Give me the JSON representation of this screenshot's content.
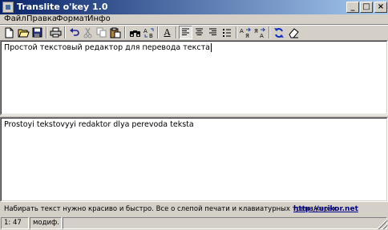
{
  "window": {
    "title": "Translite o'key 1.0",
    "minimize": "_",
    "maximize": "□",
    "close": "×"
  },
  "menu": [
    "Файл",
    "Правка",
    "Формат",
    "Инфо"
  ],
  "toolbar": {
    "buttons": [
      "new-file",
      "open-folder",
      "save",
      "print",
      "undo",
      "cut",
      "copy",
      "paste",
      "find",
      "replace",
      "font",
      "align-left",
      "align-center",
      "align-right",
      "bullet-list",
      "transliterate-forward",
      "transliterate-backward",
      "convert",
      "clear"
    ],
    "font_glyph": "A",
    "accent": "#0a246a"
  },
  "editor": {
    "source_text": "Простой текстовый редактор для перевода текста",
    "output_text": "Prostoyi tekstovyyi redaktor dlya perevoda teksta"
  },
  "footer": {
    "hint": "Набирать текст нужно красиво и быстро. Все о слепой печати и клавиатурных тренажерах.",
    "link": "http://urikor.net"
  },
  "status": {
    "position": "1:   47",
    "mode": "модиф."
  }
}
